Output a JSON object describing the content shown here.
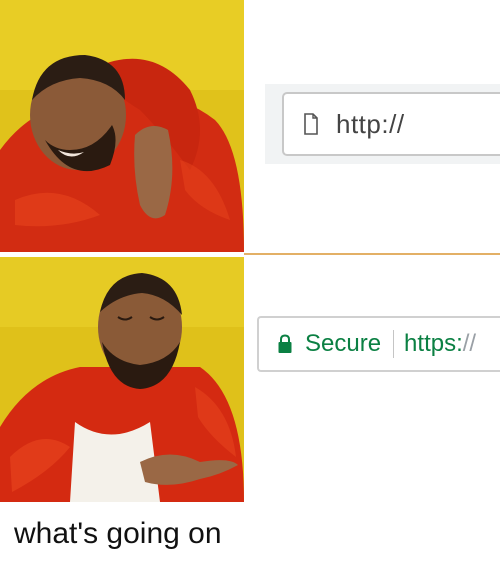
{
  "top_panel": {
    "url_text": "http://"
  },
  "bottom_panel": {
    "secure_label": "Secure",
    "https_scheme": "https:",
    "https_slashes": "//"
  },
  "caption": "what's going on",
  "icons": {
    "top": "document-icon",
    "bottom": "lock-icon"
  },
  "colors": {
    "secure_green": "#0b8043",
    "jacket_red": "#d62a12",
    "background_yellow": "#e2c21a"
  }
}
